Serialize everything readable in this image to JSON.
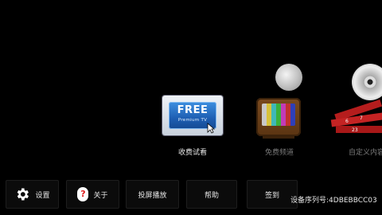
{
  "carousel": {
    "items": [
      {
        "label": "收费试看",
        "state": "selected",
        "tile_title": "FREE",
        "tile_subtitle": "Premium TV",
        "icon": "free-premium-tv-icon"
      },
      {
        "label": "免费频道",
        "state": "dim",
        "icon": "retro-tv-icon"
      },
      {
        "label": "自定义内容",
        "state": "dim",
        "icon": "cd-custom-content-icon"
      }
    ]
  },
  "bottom_bar": {
    "buttons": [
      {
        "label": "设置",
        "icon": "gear-icon"
      },
      {
        "label": "关于",
        "icon": "question-icon"
      },
      {
        "label": "投屏播放"
      },
      {
        "label": "帮助"
      },
      {
        "label": "签到"
      }
    ],
    "serial_text": "设备序列号:4DBEBBCC03"
  },
  "colors": {
    "background": "#000000",
    "accent_blue": "#1e5fb3",
    "label_dim": "#7a7a7a",
    "help_red": "#e02020"
  }
}
